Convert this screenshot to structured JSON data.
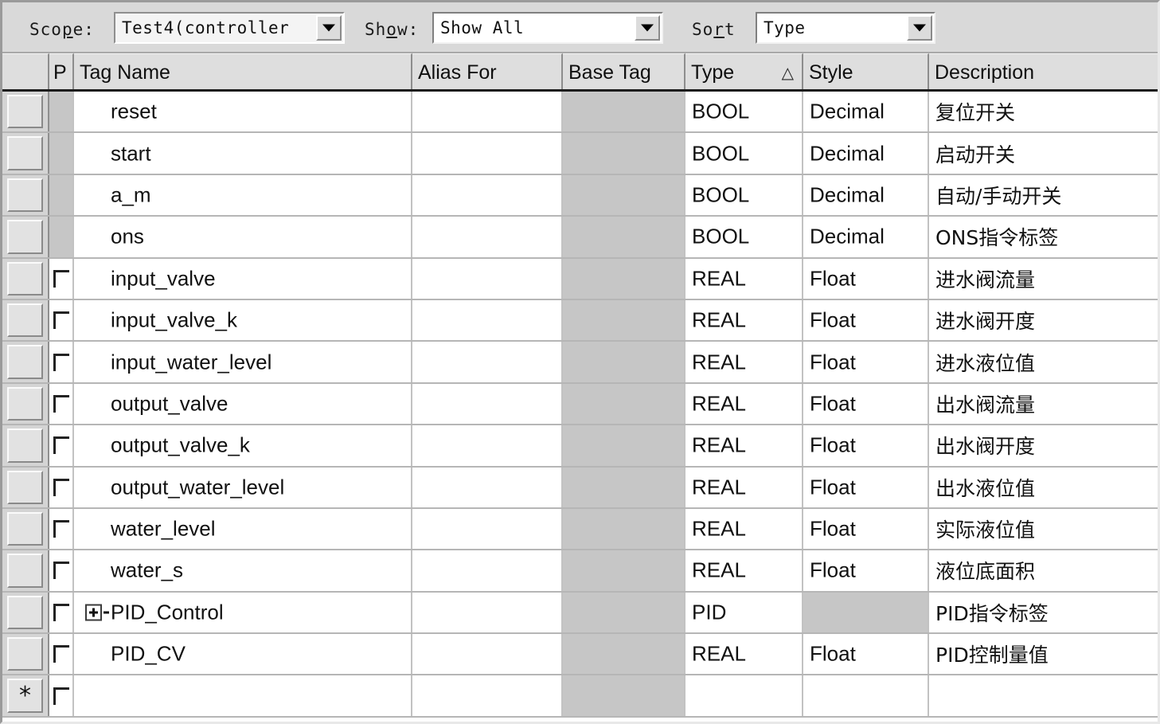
{
  "toolbar": {
    "scope": {
      "label_prefix": "Sco",
      "label_acc": "p",
      "label_suffix": "e:",
      "value": "Test4(controller",
      "icon": "chevron-down-icon"
    },
    "show": {
      "label_prefix": "Sh",
      "label_acc": "o",
      "label_suffix": "w:",
      "value": "Show All",
      "icon": "chevron-down-icon"
    },
    "sort": {
      "label_prefix": "So",
      "label_acc": "r",
      "label_suffix": "t",
      "value": "Type",
      "icon": "chevron-down-icon"
    }
  },
  "grid": {
    "columns": [
      {
        "key": "selector",
        "label": ""
      },
      {
        "key": "p",
        "label": "P"
      },
      {
        "key": "tag_name",
        "label": "Tag Name"
      },
      {
        "key": "alias_for",
        "label": "Alias For"
      },
      {
        "key": "base_tag",
        "label": "Base Tag"
      },
      {
        "key": "type",
        "label": "Type",
        "sort_indicator": "△"
      },
      {
        "key": "style",
        "label": "Style"
      },
      {
        "key": "description",
        "label": "Description"
      }
    ],
    "rows": [
      {
        "selector": "",
        "p_checkbox": false,
        "tag_name": "reset",
        "alias_for": "",
        "base_tag": "",
        "type": "BOOL",
        "style": "Decimal",
        "description": "复位开关",
        "style_disabled": false,
        "expandable": false
      },
      {
        "selector": "",
        "p_checkbox": false,
        "tag_name": "start",
        "alias_for": "",
        "base_tag": "",
        "type": "BOOL",
        "style": "Decimal",
        "description": "启动开关",
        "style_disabled": false,
        "expandable": false
      },
      {
        "selector": "",
        "p_checkbox": false,
        "tag_name": "a_m",
        "alias_for": "",
        "base_tag": "",
        "type": "BOOL",
        "style": "Decimal",
        "description": "自动/手动开关",
        "style_disabled": false,
        "expandable": false
      },
      {
        "selector": "",
        "p_checkbox": false,
        "tag_name": "ons",
        "alias_for": "",
        "base_tag": "",
        "type": "BOOL",
        "style": "Decimal",
        "description": "ONS指令标签",
        "style_disabled": false,
        "expandable": false
      },
      {
        "selector": "",
        "p_checkbox": true,
        "tag_name": "input_valve",
        "alias_for": "",
        "base_tag": "",
        "type": "REAL",
        "style": "Float",
        "description": "进水阀流量",
        "style_disabled": false,
        "expandable": false
      },
      {
        "selector": "",
        "p_checkbox": true,
        "tag_name": "input_valve_k",
        "alias_for": "",
        "base_tag": "",
        "type": "REAL",
        "style": "Float",
        "description": "进水阀开度",
        "style_disabled": false,
        "expandable": false
      },
      {
        "selector": "",
        "p_checkbox": true,
        "tag_name": "input_water_level",
        "alias_for": "",
        "base_tag": "",
        "type": "REAL",
        "style": "Float",
        "description": "进水液位值",
        "style_disabled": false,
        "expandable": false
      },
      {
        "selector": "",
        "p_checkbox": true,
        "tag_name": "output_valve",
        "alias_for": "",
        "base_tag": "",
        "type": "REAL",
        "style": "Float",
        "description": "出水阀流量",
        "style_disabled": false,
        "expandable": false
      },
      {
        "selector": "",
        "p_checkbox": true,
        "tag_name": "output_valve_k",
        "alias_for": "",
        "base_tag": "",
        "type": "REAL",
        "style": "Float",
        "description": "出水阀开度",
        "style_disabled": false,
        "expandable": false
      },
      {
        "selector": "",
        "p_checkbox": true,
        "tag_name": "output_water_level",
        "alias_for": "",
        "base_tag": "",
        "type": "REAL",
        "style": "Float",
        "description": "出水液位值",
        "style_disabled": false,
        "expandable": false
      },
      {
        "selector": "",
        "p_checkbox": true,
        "tag_name": "water_level",
        "alias_for": "",
        "base_tag": "",
        "type": "REAL",
        "style": "Float",
        "description": "实际液位值",
        "style_disabled": false,
        "expandable": false
      },
      {
        "selector": "",
        "p_checkbox": true,
        "tag_name": "water_s",
        "alias_for": "",
        "base_tag": "",
        "type": "REAL",
        "style": "Float",
        "description": "液位底面积",
        "style_disabled": false,
        "expandable": false
      },
      {
        "selector": "",
        "p_checkbox": true,
        "tag_name": "PID_Control",
        "alias_for": "",
        "base_tag": "",
        "type": "PID",
        "style": "",
        "description": "PID指令标签",
        "style_disabled": true,
        "expandable": true
      },
      {
        "selector": "",
        "p_checkbox": true,
        "tag_name": "PID_CV",
        "alias_for": "",
        "base_tag": "",
        "type": "REAL",
        "style": "Float",
        "description": "PID控制量值",
        "style_disabled": false,
        "expandable": false
      },
      {
        "selector": "*",
        "p_checkbox": true,
        "tag_name": "",
        "alias_for": "",
        "base_tag": "",
        "type": "",
        "style": "",
        "description": "",
        "style_disabled": false,
        "expandable": false
      }
    ]
  },
  "colors": {
    "window_bg": "#d9d9d9",
    "grid_bg": "#ffffff",
    "header_bg": "#dedede",
    "disabled_cell": "#c6c6c6",
    "grid_line": "#b6b6b6",
    "text": "#111111"
  }
}
